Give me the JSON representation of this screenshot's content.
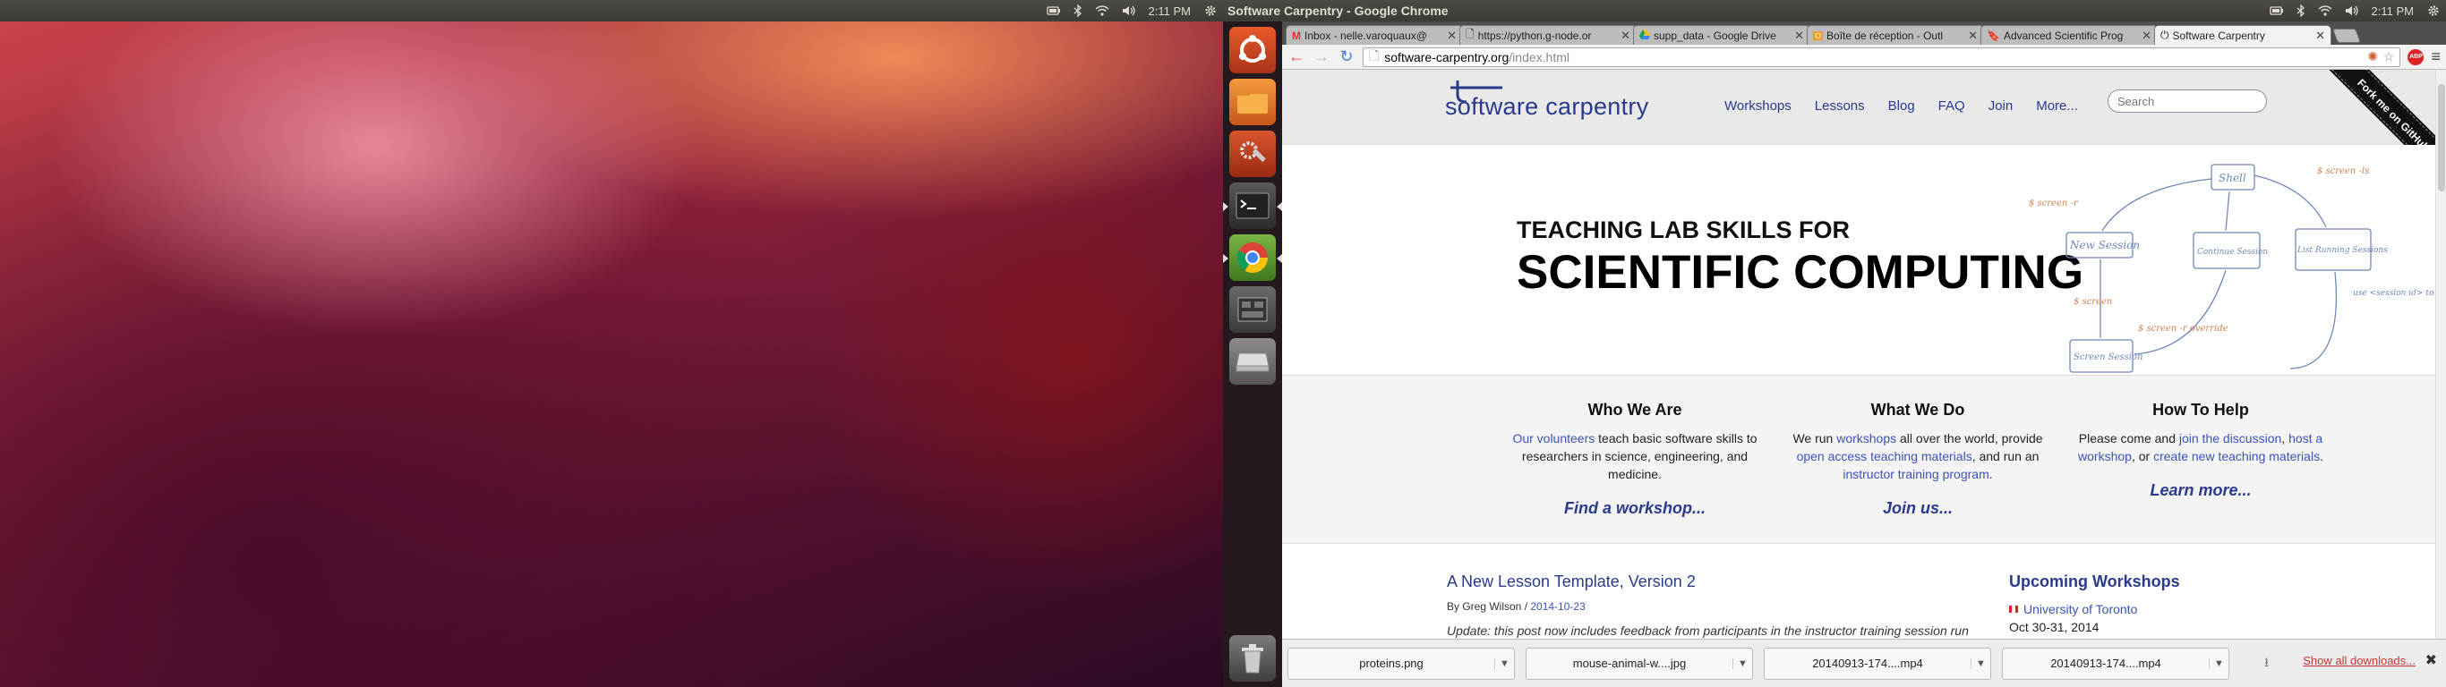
{
  "left_panel": {
    "indicators": [
      "battery-icon",
      "bluetooth-icon",
      "wifi-icon",
      "volume-icon"
    ],
    "clock": "2:11 PM",
    "session": "gear-icon"
  },
  "right_panel": {
    "window_title": "Software Carpentry - Google Chrome",
    "clock": "2:11 PM"
  },
  "launcher": {
    "items": [
      "ubuntu-dash-icon",
      "files-icon",
      "system-settings-icon",
      "terminal-icon",
      "chrome-icon",
      "workspace-switcher-icon",
      "drive-icon"
    ],
    "trash": "trash-icon"
  },
  "browser": {
    "tabs": [
      {
        "label": "Inbox - nelle.varoquaux@",
        "icon": "gmail-icon"
      },
      {
        "label": "https://python.g-node.or",
        "icon": "page-icon"
      },
      {
        "label": "supp_data - Google Drive",
        "icon": "drive-icon"
      },
      {
        "label": "Boîte de réception - Outl",
        "icon": "outlook-icon"
      },
      {
        "label": "Advanced Scientific Prog",
        "icon": "github-icon"
      },
      {
        "label": "Software Carpentry",
        "icon": "power-icon"
      }
    ],
    "url_host": "software-carpentry.org",
    "url_path": "/index.html",
    "extension_badge": "ABP"
  },
  "site": {
    "logo": "software carpentry",
    "nav": [
      "Workshops",
      "Lessons",
      "Blog",
      "FAQ",
      "Join",
      "More..."
    ],
    "search_placeholder": "Search",
    "ribbon": "Fork me on GitHub",
    "hero_sub": "TEACHING LAB SKILLS FOR",
    "hero_main": "SCIENTIFIC COMPUTING",
    "sketch": {
      "shell": "Shell",
      "new_session": "New Session",
      "continue_session": "Continue Session",
      "list_running": "List Running Sessions",
      "screen_session": "Screen Session",
      "screen": "$ screen",
      "screen_ls": "$ screen -ls",
      "screen_r": "$ screen -r",
      "use_session_id": "use <session id> to continue",
      "screen_or_override": "$ screen -r override"
    },
    "columns": [
      {
        "title": "Who We Are",
        "link1": "Our volunteers",
        "text1": " teach basic software skills to researchers in science, engineering, and medicine.",
        "more": "Find a workshop..."
      },
      {
        "title": "What We Do",
        "text0": "We run ",
        "link1": "workshops",
        "text1": " all over the world, provide ",
        "link2": "open access teaching materials",
        "text2": ", and run an ",
        "link3": "instructor training program",
        "text3": ".",
        "more": "Join us..."
      },
      {
        "title": "How To Help",
        "text0": "Please come and ",
        "link1": "join the discussion",
        "text1": ", ",
        "link2": "host a workshop",
        "text2": ", or ",
        "link3": "create new teaching materials",
        "text3": ".",
        "more": "Learn more..."
      }
    ],
    "post": {
      "title": "A New Lesson Template, Version 2",
      "byline": "By Greg Wilson / ",
      "date": "2014-10-23",
      "excerpt": "Update: this post now includes feedback from participants in the instructor training session run"
    },
    "upcoming": {
      "title": "Upcoming Workshops",
      "workshop": "University of Toronto",
      "date": "Oct 30-31, 2014"
    }
  },
  "downloads": {
    "items": [
      "proteins.png",
      "mouse-animal-w....jpg",
      "20140913-174....mp4",
      "20140913-174....mp4"
    ],
    "show_all": "Show all downloads..."
  }
}
